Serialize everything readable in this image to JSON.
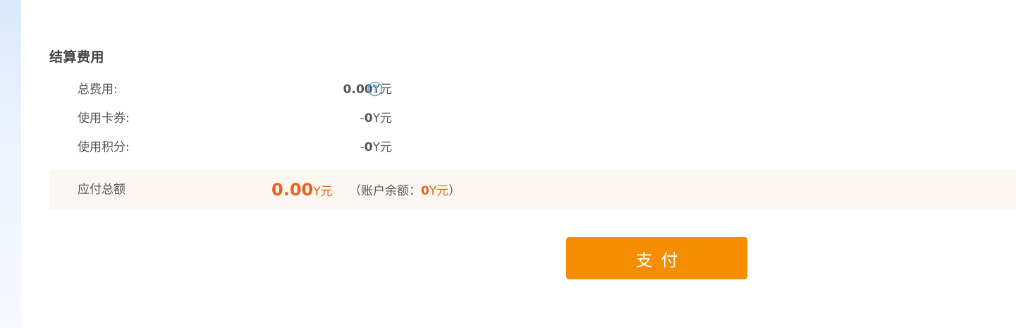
{
  "settlement": {
    "title": "结算费用",
    "rows": [
      {
        "label": "总费用:",
        "sign": "",
        "value": "0.00",
        "unit": "Y元"
      },
      {
        "label": "使用卡券:",
        "sign": "-",
        "value": "0",
        "unit": "Y元"
      },
      {
        "label": "使用积分:",
        "sign": "-",
        "value": "0",
        "unit": "Y元"
      }
    ],
    "help_icon": "question-circle-icon",
    "total": {
      "label": "应付总额",
      "value": "0.00",
      "unit": "Y元",
      "balance_prefix": "（账户余额：",
      "balance_value": "0",
      "balance_unit": "Y元",
      "balance_suffix": "）"
    },
    "pay_button_label": "支付"
  },
  "colors": {
    "accent_orange": "#f68c00",
    "amount_orange": "#e8631f",
    "total_bar_bg": "#fdf7f1",
    "help_icon_blue": "#6aa6dc"
  }
}
